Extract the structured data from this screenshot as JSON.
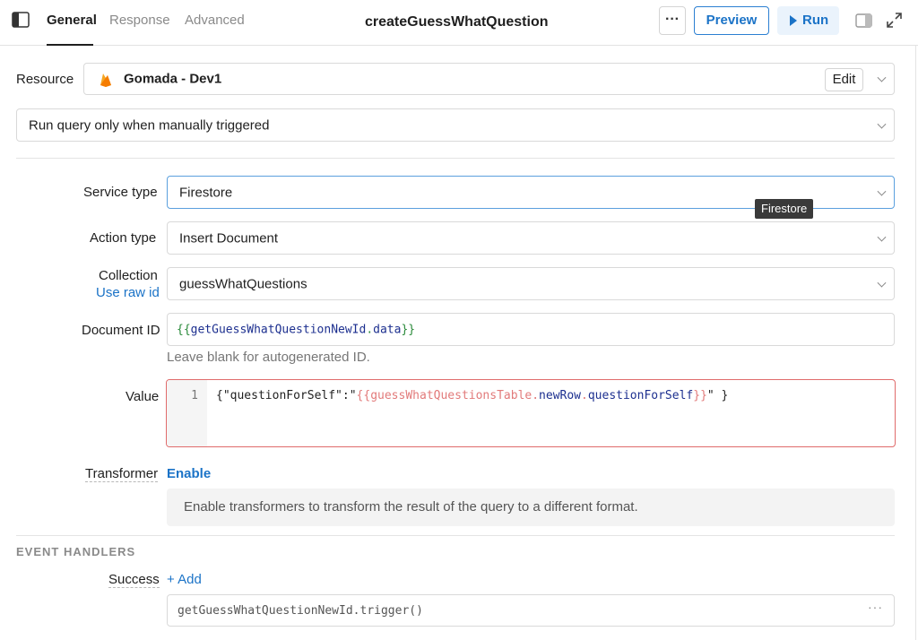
{
  "header": {
    "tabs": [
      {
        "label": "General",
        "active": true
      },
      {
        "label": "Response",
        "active": false
      },
      {
        "label": "Advanced",
        "active": false
      }
    ],
    "title": "createGuessWhatQuestion",
    "more_label": "···",
    "preview_label": "Preview",
    "run_label": "Run"
  },
  "resource": {
    "label": "Resource",
    "value": "Gomada - Dev1",
    "icon": "firebase-icon",
    "edit_label": "Edit"
  },
  "trigger": {
    "value": "Run query only when manually triggered"
  },
  "service_type": {
    "label": "Service type",
    "value": "Firestore",
    "tooltip": "Firestore"
  },
  "action_type": {
    "label": "Action type",
    "value": "Insert Document"
  },
  "collection": {
    "label": "Collection",
    "raw_id_link": "Use raw id",
    "value": "guessWhatQuestions"
  },
  "document_id": {
    "label": "Document ID",
    "open": "{{",
    "var": "getGuessWhatQuestionNewId",
    "dot": ".",
    "prop": "data",
    "close": "}}",
    "hint": "Leave blank for autogenerated ID."
  },
  "value_editor": {
    "label": "Value",
    "line_number": "1",
    "prefix": "{\"questionForSelf\":\"",
    "tpl_open": "{{",
    "tpl_var": "guessWhatQuestionsTable",
    "dot1": ".",
    "tpl_prop1": "newRow",
    "dot2": ".",
    "tpl_prop2": "questionForSelf",
    "tpl_close": "}}",
    "suffix": "\" }"
  },
  "transformer": {
    "label": "Transformer",
    "enable_label": "Enable",
    "info": "Enable transformers to transform the result of the query to a different format."
  },
  "event_handlers": {
    "section_label": "EVENT HANDLERS",
    "success_label": "Success",
    "add_label": "+ Add",
    "handlers": [
      {
        "value": "getGuessWhatQuestionNewId.trigger()",
        "menu": "···"
      }
    ]
  },
  "colors": {
    "accent": "#1b73c7",
    "error_border": "#e06b6b",
    "focus_border": "#5ba0de"
  }
}
